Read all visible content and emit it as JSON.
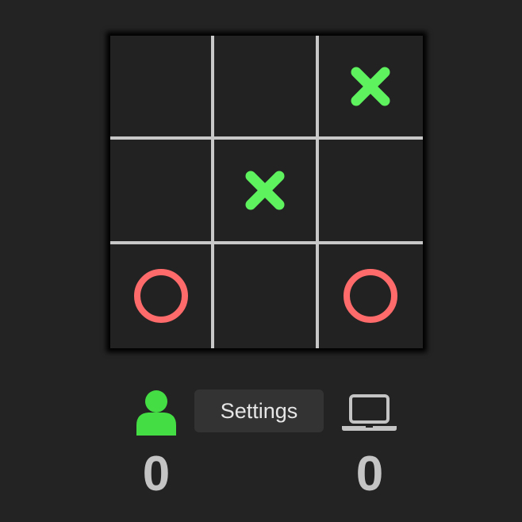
{
  "board": {
    "cells": [
      "",
      "",
      "X",
      "",
      "X",
      "",
      "O",
      "",
      "O"
    ]
  },
  "controls": {
    "settings_label": "Settings",
    "player_icon": "user-icon",
    "computer_icon": "laptop-icon"
  },
  "scores": {
    "player": "0",
    "computer": "0"
  },
  "colors": {
    "background": "#232323",
    "board": "#222222",
    "grid": "#c8c8c8",
    "x_mark": "#5ef25e",
    "o_mark": "#ff6b6b",
    "player_icon": "#44dd44",
    "computer_icon": "#c4c4c4",
    "button_bg": "#333333"
  }
}
